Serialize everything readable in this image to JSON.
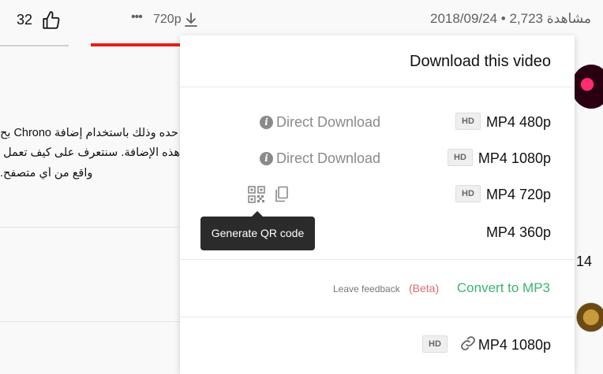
{
  "video_bar": {
    "like_count": "32",
    "more_dots": "•••",
    "quality_label": "720p",
    "meta": "2018/09/24 • مشاهدة 2,723"
  },
  "description": {
    "line1": "حده وذلك باستخدام إضافة Chrono بح",
    "line2": "هذه الإضافة. سنتعرف على كيف تعمل ه",
    "line3": "واقع من أي متصفح."
  },
  "sidebar": {
    "partial_number": "14"
  },
  "popup": {
    "title": "Download this video",
    "hd_label": "HD",
    "direct_download_label": "Direct Download",
    "formats": [
      {
        "label": "MP4 480p",
        "hd": true,
        "direct": true
      },
      {
        "label": "MP4 1080p",
        "hd": true,
        "direct": true
      },
      {
        "label": "MP4 720p",
        "hd": true,
        "direct": false
      },
      {
        "label": "MP4 360p",
        "hd": false,
        "direct": false
      }
    ],
    "tooltip": "Generate QR code",
    "leave_feedback": "Leave feedback",
    "beta": "(Beta)",
    "convert_mp3": "Convert to MP3",
    "bottom_format": "MP4 1080p"
  },
  "colors": {
    "accent_green": "#3cb371",
    "beta_red": "#e06b6b",
    "progress_red": "#e62117",
    "tooltip_bg": "#2b2b2b"
  },
  "icons": [
    "thumbs-up-icon",
    "download-icon",
    "info-icon",
    "qr-code-icon",
    "copy-icon",
    "link-icon"
  ]
}
